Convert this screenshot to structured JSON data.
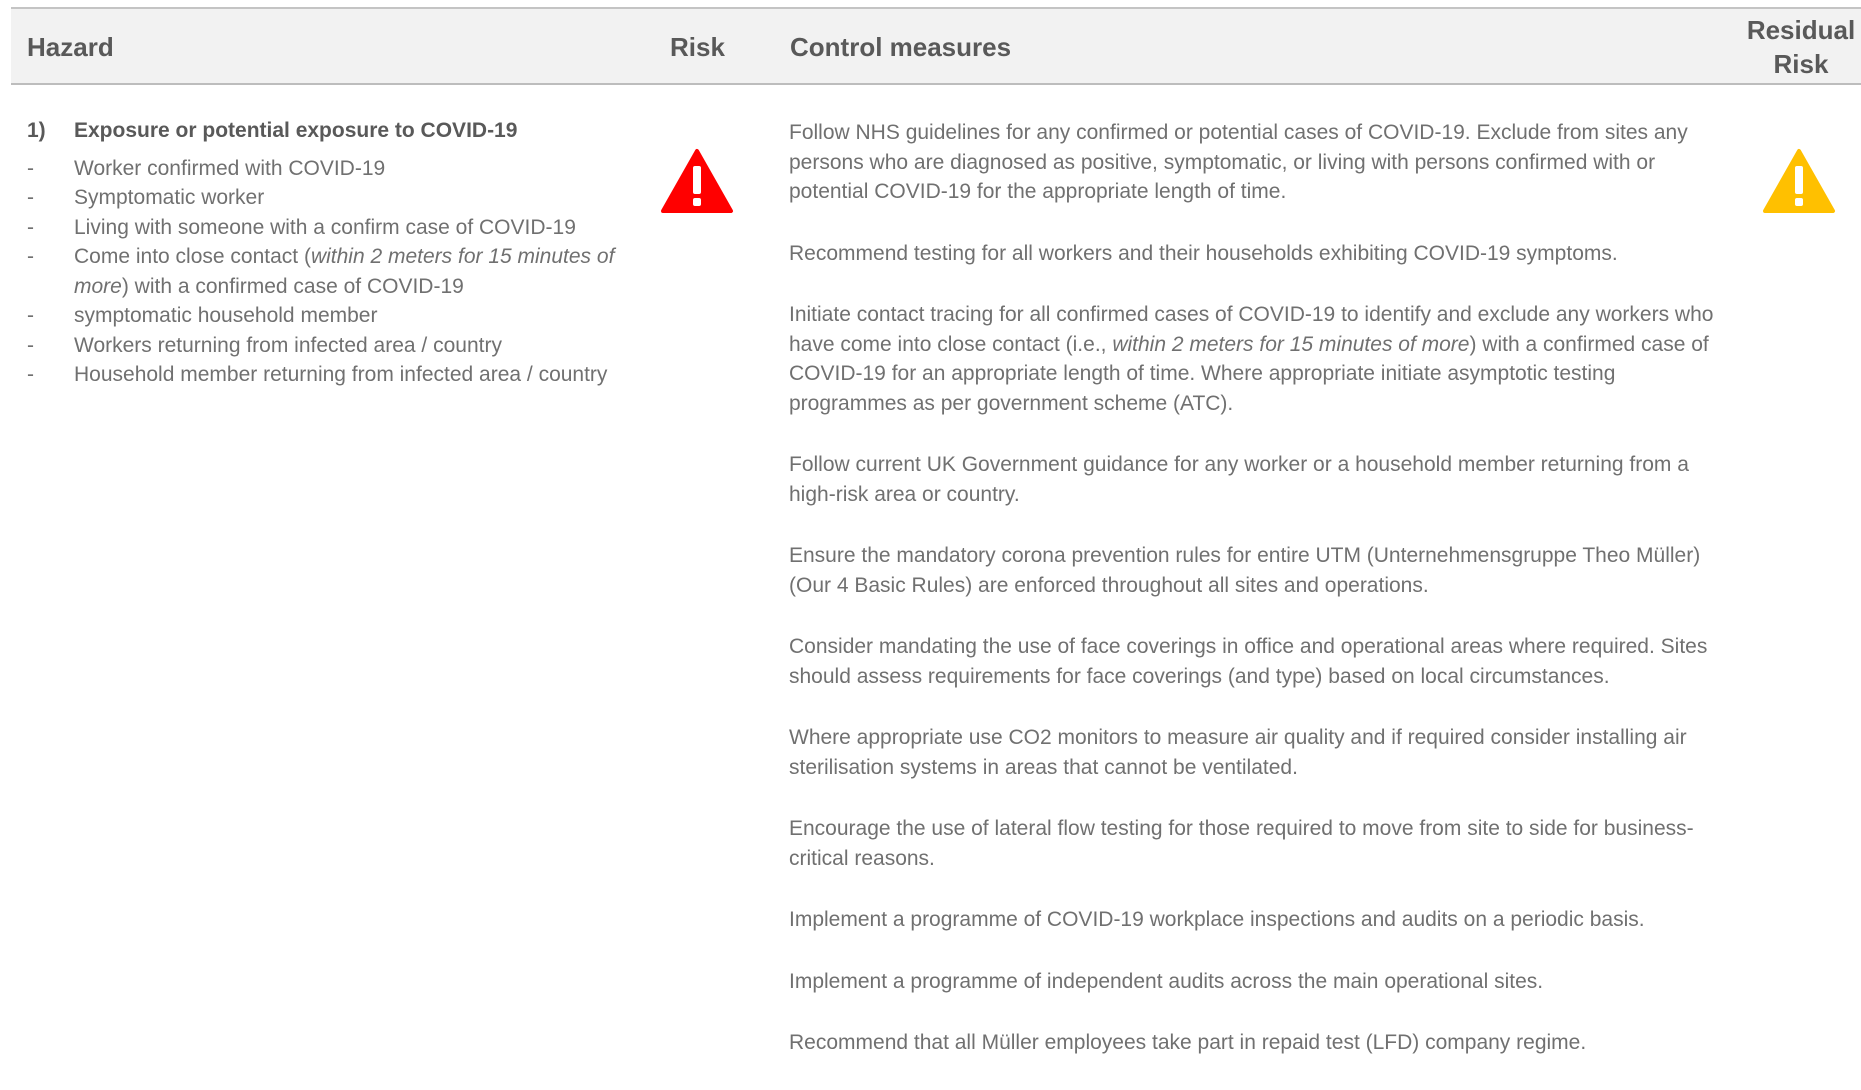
{
  "header": {
    "hazard": "Hazard",
    "risk": "Risk",
    "control": "Control measures",
    "residual_line1": "Residual",
    "residual_line2": "Risk"
  },
  "hazard": {
    "number": "1)",
    "title": "Exposure or potential exposure to COVID-19",
    "bullet_symbol": "-",
    "items": [
      {
        "text": "Worker confirmed with COVID-19"
      },
      {
        "text": "Symptomatic worker"
      },
      {
        "text": "Living with someone with a confirm case of COVID-19"
      },
      {
        "pre": "Come into close contact (",
        "em": "within 2 meters for 15 minutes of more",
        "post": ") with a confirmed case of COVID-19"
      },
      {
        "text": "symptomatic household member"
      },
      {
        "text": "Workers returning from infected area / country"
      },
      {
        "text": "Household member returning from infected area / country"
      }
    ]
  },
  "risk_icon": {
    "name": "warning-triangle-icon",
    "color": "#ff0000"
  },
  "residual_icon": {
    "name": "warning-triangle-icon",
    "color": "#ffc000"
  },
  "controls": [
    {
      "text": "Follow NHS guidelines for any confirmed or potential cases of COVID-19. Exclude from sites any persons who are diagnosed as positive, symptomatic, or living with persons confirmed with or potential COVID-19 for the appropriate length of time."
    },
    {
      "text": "Recommend testing for all workers and their households exhibiting COVID-19 symptoms."
    },
    {
      "pre": "Initiate contact tracing for all confirmed cases of COVID-19 to identify and exclude any workers who have come into close contact (i.e., ",
      "em": "within 2 meters for 15 minutes of more",
      "post": ") with a confirmed case of COVID-19 for an appropriate length of time. Where appropriate initiate asymptotic testing programmes as per government scheme (ATC)."
    },
    {
      "text": "Follow current UK Government guidance for any worker or a household member returning from a high-risk area or country."
    },
    {
      "text": "Ensure the mandatory corona prevention rules for entire UTM (Unternehmensgruppe Theo Müller) (Our 4 Basic Rules) are enforced throughout all sites and operations."
    },
    {
      "text": "Consider mandating the use of face coverings in office and operational areas where required. Sites should assess requirements for face coverings (and type) based on local circumstances."
    },
    {
      "text": "Where appropriate use CO2 monitors to measure air quality and if required consider installing air sterilisation systems in areas that cannot be ventilated."
    },
    {
      "text": "Encourage the use of lateral flow testing for those required to move from site to side for business-critical reasons."
    },
    {
      "text": "Implement a programme of COVID-19 workplace inspections and audits on a periodic basis."
    },
    {
      "text": "Implement a programme of independent audits across the main operational sites."
    },
    {
      "text": "Recommend that all Müller employees take part in repaid test (LFD) company regime."
    }
  ]
}
